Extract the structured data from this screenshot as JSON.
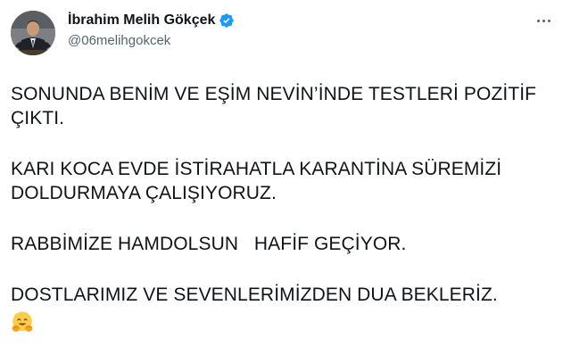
{
  "author": {
    "name": "İbrahim Melih Gökçek",
    "handle": "@06melihgokcek",
    "verified": true
  },
  "tweet": {
    "paragraphs": [
      "SONUNDA BENİM VE EŞİM NEVİN’İNDE TESTLERİ POZİTİF ÇIKTI.",
      "KARI KOCA EVDE İSTİRAHATLA KARANTİNA SÜREMİZİ DOLDURMAYA ÇALIŞIYORUZ.",
      "RABBİMİZE HAMDOLSUN   HAFİF GEÇİYOR.",
      "DOSTLARIMIZ VE SEVENLERİMİZDEN DUA BEKLERİZ."
    ],
    "emoji": "hugging-face-icon"
  },
  "icons": {
    "verified": "verified-badge-icon",
    "more": "more-options-icon"
  },
  "colors": {
    "text": "#0f1419",
    "secondary": "#536471",
    "verified_blue": "#1d9bf0",
    "emoji_yellow": "#ffcc4d"
  }
}
